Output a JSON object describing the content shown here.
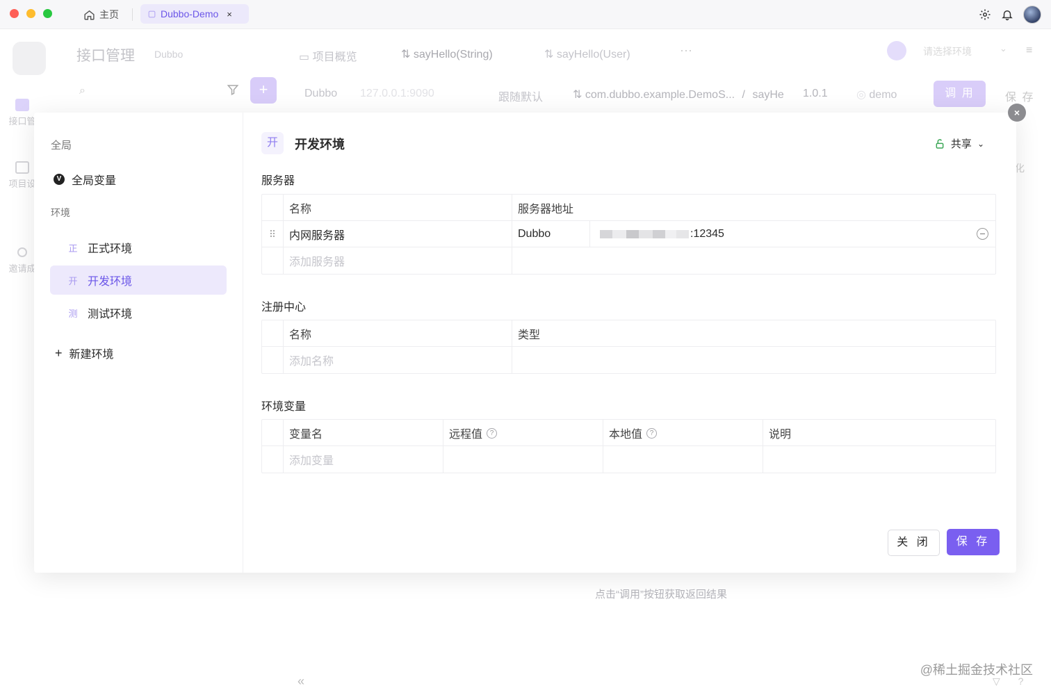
{
  "titlebar": {
    "home_tab": "主页",
    "app_tab": "Dubbo-Demo",
    "app_tab_close": "×"
  },
  "background": {
    "page_title": "接口管理",
    "page_sub": "Dubbo",
    "tabs": [
      {
        "icon": "▭",
        "label": "项目概览"
      },
      {
        "icon": "⇅",
        "label": "sayHello(String)"
      },
      {
        "icon": "⇅",
        "label": "sayHello(User)"
      }
    ],
    "more": "···",
    "env_select": "请选择环境",
    "request": {
      "protocol": "Dubbo",
      "address": "127.0.0.1:9090",
      "follow": "跟随默认",
      "service": "com.dubbo.example.DemoS...",
      "sep": "/",
      "method": "sayHe",
      "version": "1.0.1",
      "group": "demo"
    },
    "call_button": "调 用",
    "save_button": "保 存",
    "side_nav": [
      "接口管",
      "项目设",
      "邀请成"
    ],
    "edge_text": "化",
    "hint": "点击“调用”按钮获取返回结果",
    "collapse": "«"
  },
  "watermark": "@稀土掘金技术社区",
  "modal": {
    "close": "×",
    "sidebar": {
      "global_section": "全局",
      "global_vars": "全局变量",
      "global_vars_badge": "V",
      "env_section": "环境",
      "envs": [
        {
          "tag": "正",
          "label": "正式环境",
          "active": false
        },
        {
          "tag": "开",
          "label": "开发环境",
          "active": true
        },
        {
          "tag": "测",
          "label": "测试环境",
          "active": false
        }
      ],
      "new_env": "新建环境"
    },
    "header": {
      "tag": "开",
      "title": "开发环境",
      "share": "共享"
    },
    "servers": {
      "title": "服务器",
      "columns": [
        "名称",
        "服务器地址"
      ],
      "rows": [
        {
          "name": "内网服务器",
          "protocol": "Dubbo",
          "port": ":12345"
        }
      ],
      "add_placeholder": "添加服务器"
    },
    "registry": {
      "title": "注册中心",
      "columns": [
        "名称",
        "类型"
      ],
      "add_placeholder": "添加名称"
    },
    "env_vars": {
      "title": "环境变量",
      "columns": [
        "变量名",
        "远程值",
        "本地值",
        "说明"
      ],
      "add_placeholder": "添加变量"
    },
    "buttons": {
      "close": "关 闭",
      "save": "保 存"
    }
  },
  "colors": {
    "accent": "#7a5ff0",
    "accent_light": "#ede9fc",
    "share_lock": "#3aa655"
  }
}
